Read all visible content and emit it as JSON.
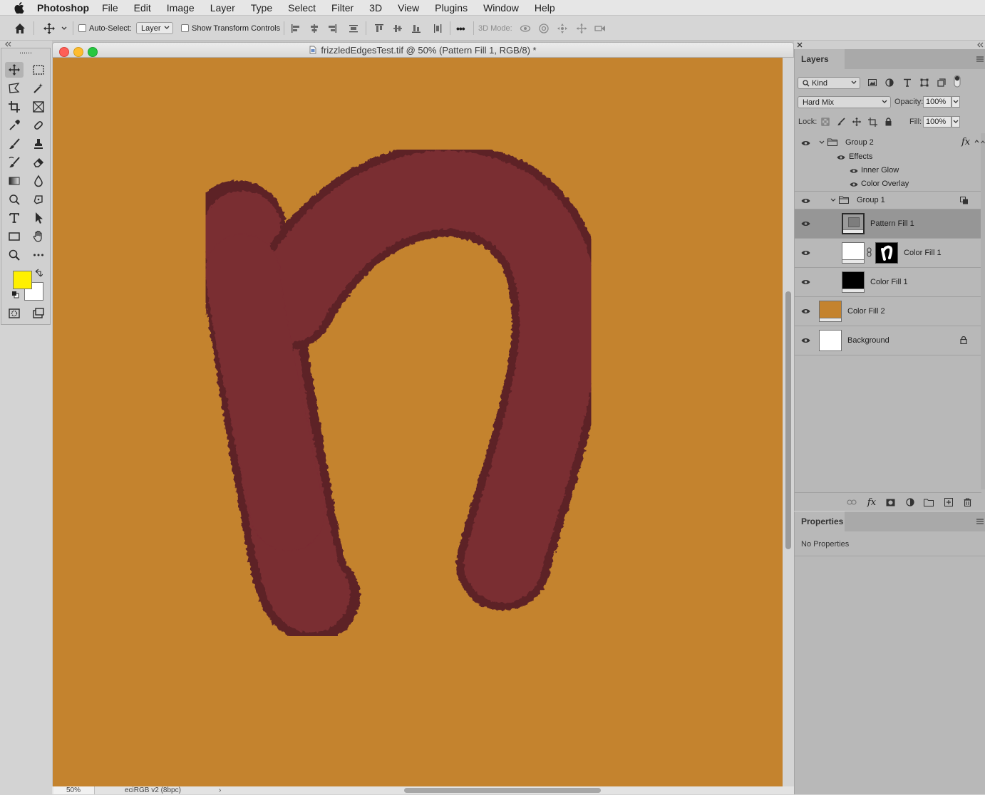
{
  "menubar": {
    "app_name": "Photoshop",
    "items": [
      "File",
      "Edit",
      "Image",
      "Layer",
      "Type",
      "Select",
      "Filter",
      "3D",
      "View",
      "Plugins",
      "Window",
      "Help"
    ]
  },
  "options_bar": {
    "auto_select_label": "Auto-Select:",
    "auto_select_checked": false,
    "auto_select_target": "Layer",
    "show_transform_label": "Show Transform Controls",
    "show_transform_checked": false,
    "more_label": "•••",
    "mode_3d_label": "3D Mode:"
  },
  "tools": {
    "active": "move-tool",
    "foreground_color": "#fff000",
    "background_color": "#ffffff"
  },
  "document": {
    "title": "frizzledEdgesTest.tif @ 50% (Pattern Fill 1, RGB/8) *",
    "zoom": "50%",
    "color_profile": "eciRGB v2 (8bpc)",
    "status_arrow": "›",
    "canvas_color": "#c4832e",
    "shape_color": "#7a2d32"
  },
  "layers_panel": {
    "tab": "Layers",
    "filter_kind": "Kind",
    "blend_mode": "Hard Mix",
    "opacity_label": "Opacity:",
    "opacity": "100%",
    "lock_label": "Lock:",
    "fill_label": "Fill:",
    "fill": "100%",
    "fx_label": "fx",
    "layers": [
      {
        "name": "Group 2",
        "type": "group",
        "visible": true,
        "expanded": true
      },
      {
        "name": "Effects",
        "type": "effects-header",
        "visible": true
      },
      {
        "name": "Inner Glow",
        "type": "effect",
        "visible": true
      },
      {
        "name": "Color Overlay",
        "type": "effect",
        "visible": true
      },
      {
        "name": "Group 1",
        "type": "group",
        "visible": true,
        "expanded": true
      },
      {
        "name": "Pattern Fill 1",
        "type": "fill",
        "visible": true,
        "selected": true
      },
      {
        "name": "Color Fill 1",
        "type": "fill-masked",
        "visible": true
      },
      {
        "name": "Color Fill 1",
        "type": "fill",
        "visible": true
      },
      {
        "name": "Color Fill 2",
        "type": "fill",
        "visible": true
      },
      {
        "name": "Background",
        "type": "background",
        "visible": true,
        "locked": true
      }
    ]
  },
  "properties_panel": {
    "tab": "Properties",
    "message": "No Properties"
  }
}
